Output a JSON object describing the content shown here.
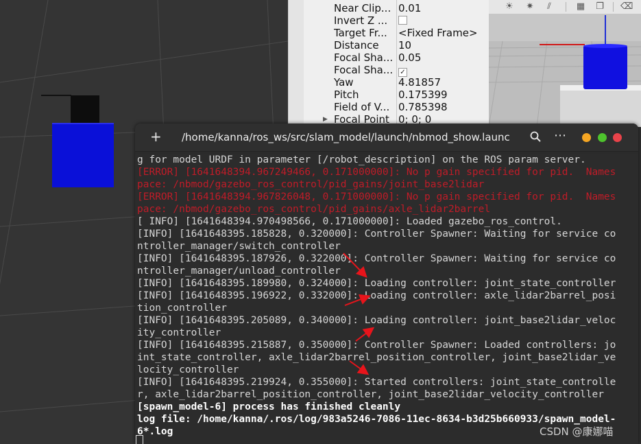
{
  "rviz_properties": [
    {
      "key": "Near Clip...",
      "value": "0.01",
      "type": "text"
    },
    {
      "key": "Invert Z ...",
      "value": "",
      "type": "checkbox",
      "checked": false
    },
    {
      "key": "Target Fr...",
      "value": "<Fixed Frame>",
      "type": "text"
    },
    {
      "key": "Distance",
      "value": "10",
      "type": "text"
    },
    {
      "key": "Focal Sha...",
      "value": "0.05",
      "type": "text"
    },
    {
      "key": "Focal Sha...",
      "value": "",
      "type": "checkbox",
      "checked": true
    },
    {
      "key": "Yaw",
      "value": "4.81857",
      "type": "text"
    },
    {
      "key": "Pitch",
      "value": "0.175399",
      "type": "text"
    },
    {
      "key": "Field of V...",
      "value": "0.785398",
      "type": "text"
    },
    {
      "key": "Focal Point",
      "value": "0; 0; 0",
      "type": "text",
      "expandable": true
    }
  ],
  "rviz_toolbar_icons": [
    "sun-icon",
    "lights-icon",
    "lines-icon",
    "grid-icon",
    "copy-icon",
    "trash-icon"
  ],
  "terminal": {
    "title": "/home/kanna/ros_ws/src/slam_model/launch/nbmod_show.launc...",
    "new_tab_glyph": "+",
    "menu_glyph": "⋯",
    "window_buttons": {
      "minimize": "#f5a623",
      "maximize": "#4ec32d",
      "close": "#e9434a"
    },
    "lines": [
      {
        "text": "g for model URDF in parameter [/robot_description] on the ROS param server.",
        "style": "normal"
      },
      {
        "text": "[ERROR] [1641648394.967249466, 0.171000000]: No p gain specified for pid.  Names",
        "style": "err"
      },
      {
        "text": "pace: /nbmod/gazebo_ros_control/pid_gains/joint_base2lidar",
        "style": "err"
      },
      {
        "text": "[ERROR] [1641648394.967826048, 0.171000000]: No p gain specified for pid.  Names",
        "style": "err"
      },
      {
        "text": "pace: /nbmod/gazebo_ros_control/pid_gains/axle_lidar2barrel",
        "style": "err"
      },
      {
        "text": "[ INFO] [1641648394.970498566, 0.171000000]: Loaded gazebo_ros_control.",
        "style": "normal"
      },
      {
        "text": "[INFO] [1641648395.185828, 0.320000]: Controller Spawner: Waiting for service co",
        "style": "normal"
      },
      {
        "text": "ntroller_manager/switch_controller",
        "style": "normal"
      },
      {
        "text": "[INFO] [1641648395.187926, 0.322000]: Controller Spawner: Waiting for service co",
        "style": "normal"
      },
      {
        "text": "ntroller_manager/unload_controller",
        "style": "normal"
      },
      {
        "text": "[INFO] [1641648395.189980, 0.324000]: Loading controller: joint_state_controller",
        "style": "normal"
      },
      {
        "text": "[INFO] [1641648395.196922, 0.332000]: Loading controller: axle_lidar2barrel_posi",
        "style": "normal"
      },
      {
        "text": "tion_controller",
        "style": "normal"
      },
      {
        "text": "[INFO] [1641648395.205089, 0.340000]: Loading controller: joint_base2lidar_veloc",
        "style": "normal"
      },
      {
        "text": "ity_controller",
        "style": "normal"
      },
      {
        "text": "[INFO] [1641648395.215887, 0.350000]: Controller Spawner: Loaded controllers: jo",
        "style": "normal"
      },
      {
        "text": "int_state_controller, axle_lidar2barrel_position_controller, joint_base2lidar_ve",
        "style": "normal"
      },
      {
        "text": "locity_controller",
        "style": "normal"
      },
      {
        "text": "[INFO] [1641648395.219924, 0.355000]: Started controllers: joint_state_controlle",
        "style": "normal"
      },
      {
        "text": "r, axle_lidar2barrel_position_controller, joint_base2lidar_velocity_controller",
        "style": "normal"
      },
      {
        "text": "[spawn_model-6] process has finished cleanly",
        "style": "bold"
      },
      {
        "text": "log file: /home/kanna/.ros/log/983a5246-7086-11ec-8634-b3d25b660933/spawn_model-",
        "style": "bold"
      },
      {
        "text": "6*.log",
        "style": "bold"
      }
    ]
  },
  "colors": {
    "error_text": "#c01c28",
    "annotation_arrow": "#e8141b",
    "robot_body": "#0a10d8",
    "robot_lidar": "#000000"
  },
  "watermark": "CSDN @康娜喵"
}
